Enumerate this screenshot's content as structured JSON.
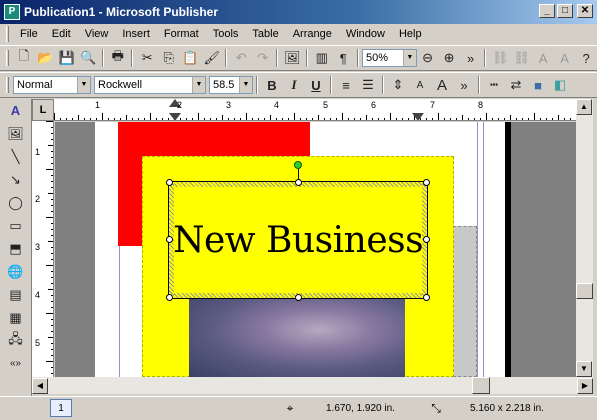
{
  "window": {
    "title": "Publication1 - Microsoft Publisher",
    "app_icon": "P",
    "minimize": "_",
    "maximize": "□",
    "close": "✕"
  },
  "menu": [
    "File",
    "Edit",
    "View",
    "Insert",
    "Format",
    "Tools",
    "Table",
    "Arrange",
    "Window",
    "Help"
  ],
  "toolbar": {
    "zoom_value": "50%"
  },
  "format_toolbar": {
    "style_value": "Normal",
    "font_value": "Rockwell",
    "size_value": "58.5"
  },
  "ruler": {
    "h_labels": [
      "1",
      "2",
      "3",
      "4",
      "5",
      "6",
      "7",
      "8"
    ],
    "v_labels": [
      "1",
      "2",
      "3",
      "4",
      "5"
    ],
    "corner": "L"
  },
  "document": {
    "headline": "New Business"
  },
  "status": {
    "page_number": "1",
    "position": "1.670, 1.920 in.",
    "size": "5.160 x  2.218 in."
  },
  "colors": {
    "title_start": "#0a246a",
    "red_block": "#ff0000",
    "yellow_block": "#ffff00",
    "rotation_handle": "#33cc33"
  }
}
